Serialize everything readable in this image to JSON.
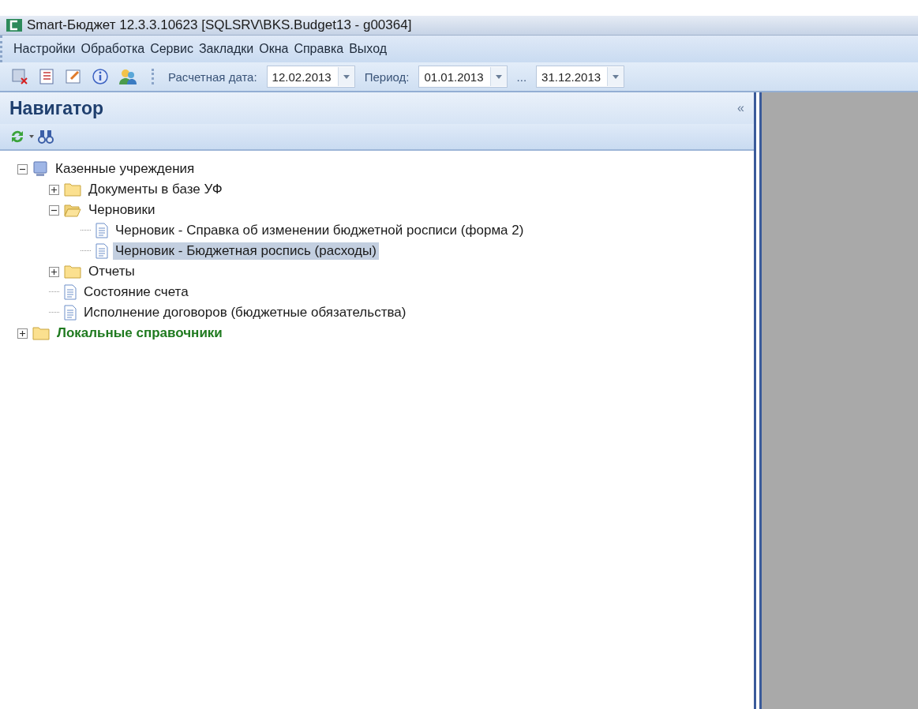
{
  "window": {
    "title": "Smart-Бюджет 12.3.3.10623 [SQLSRV\\BKS.Budget13 - g00364]"
  },
  "menu": [
    "Настройки",
    "Обработка",
    "Сервис",
    "Закладки",
    "Окна",
    "Справка",
    "Выход"
  ],
  "toolbar": {
    "calc_date": {
      "label": "Расчетная дата:",
      "value": "12.02.2013"
    },
    "period": {
      "label": "Период:",
      "from": "01.01.2013",
      "separator": "...",
      "to": "31.12.2013"
    }
  },
  "navigator": {
    "title": "Навигатор",
    "collapse": "«",
    "tree": [
      {
        "label": "Казенные учреждения",
        "kind": "computer",
        "expanded": true,
        "selected": false,
        "emphasis": false,
        "children": [
          {
            "label": "Документы в базе УФ",
            "kind": "folder",
            "expanded": false,
            "selected": false,
            "emphasis": false
          },
          {
            "label": "Черновики",
            "kind": "folder",
            "expanded": true,
            "selected": false,
            "emphasis": false,
            "children": [
              {
                "label": "Черновик - Справка об изменении бюджетной росписи (форма 2)",
                "kind": "document",
                "selected": false,
                "emphasis": false
              },
              {
                "label": "Черновик - Бюджетная роспись (расходы)",
                "kind": "document",
                "selected": true,
                "emphasis": false
              }
            ]
          },
          {
            "label": "Отчеты",
            "kind": "folder",
            "expanded": false,
            "selected": false,
            "emphasis": false
          },
          {
            "label": "Состояние счета",
            "kind": "document",
            "selected": false,
            "emphasis": false
          },
          {
            "label": "Исполнение договоров (бюджетные обязательства)",
            "kind": "document",
            "selected": false,
            "emphasis": false
          }
        ]
      },
      {
        "label": "Локальные справочники",
        "kind": "folder",
        "expanded": false,
        "selected": false,
        "emphasis": true
      }
    ]
  }
}
